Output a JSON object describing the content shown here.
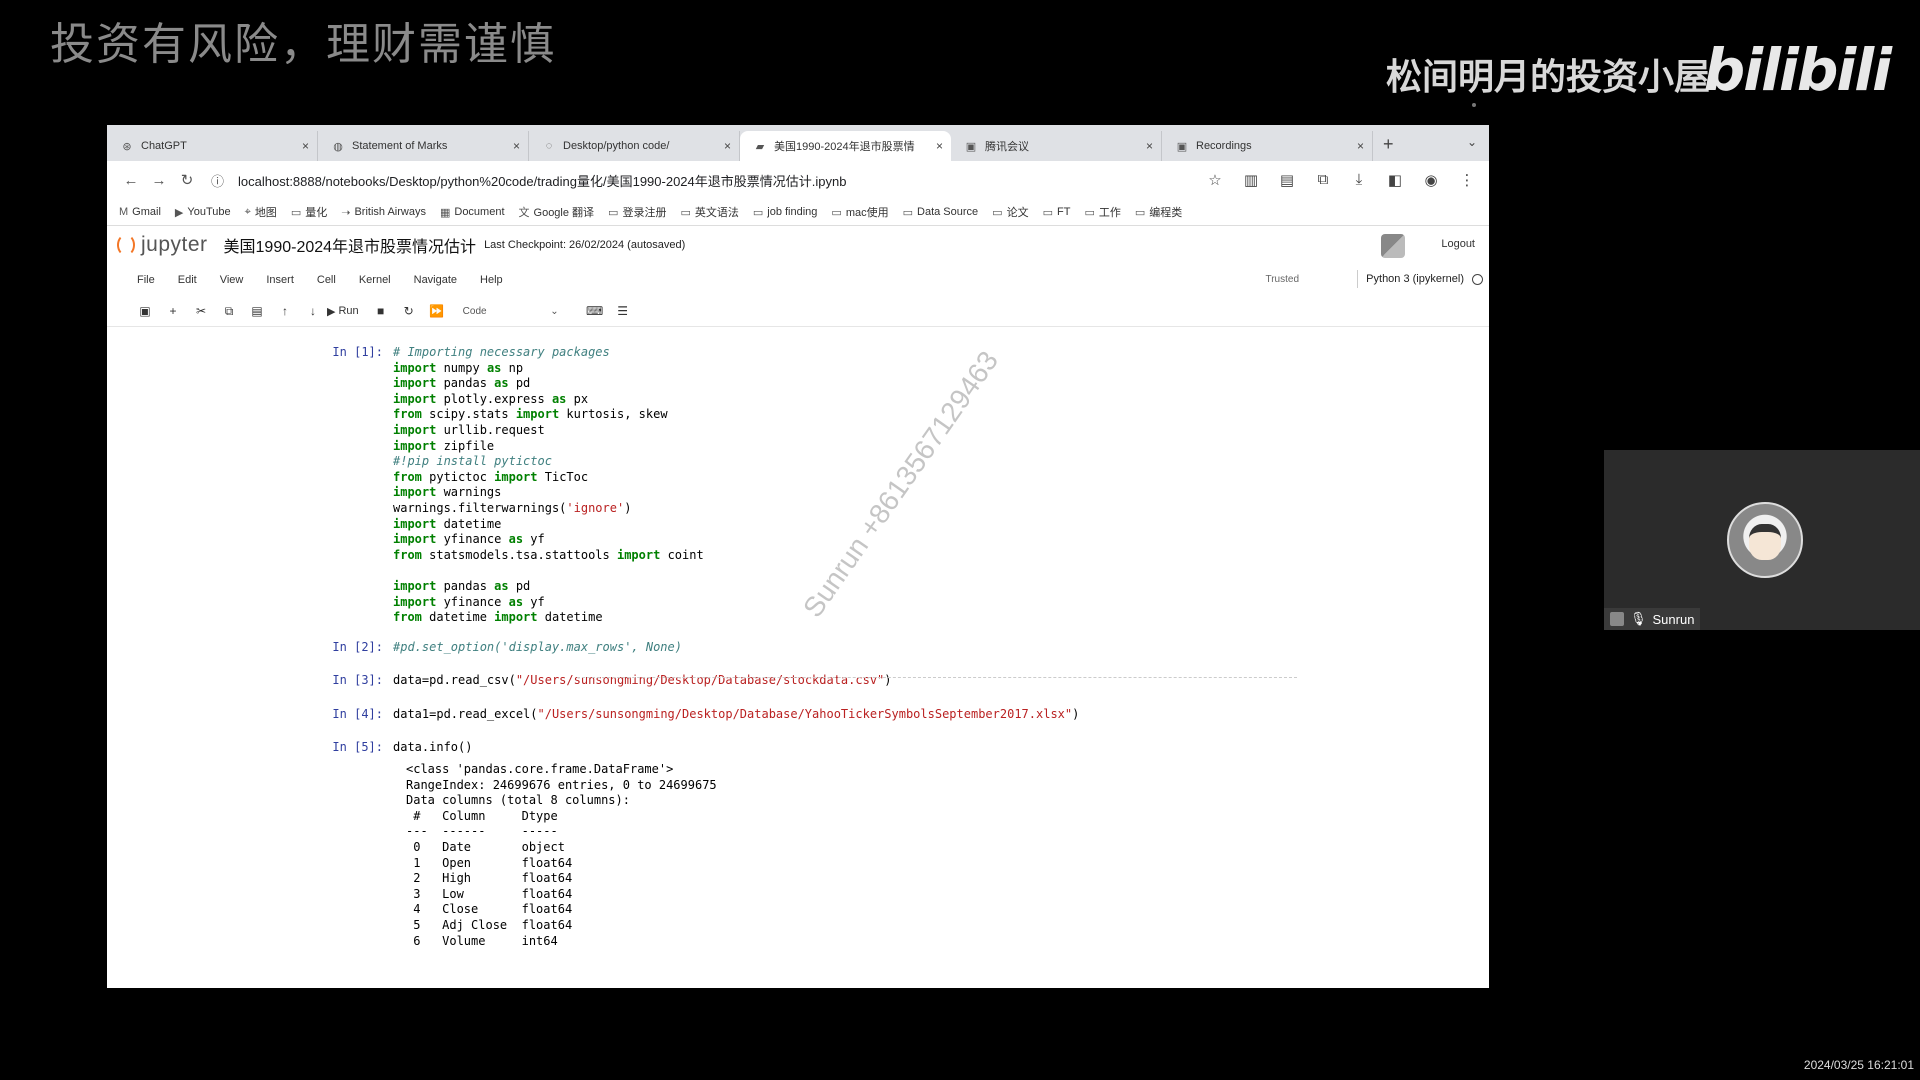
{
  "overlay": {
    "warning": "投资有风险，理财需谨慎",
    "brand": "松间明月的投资小屋",
    "logo": "bilibili",
    "timestamp": "2024/03/25 16:21:01"
  },
  "browser": {
    "tabs": [
      {
        "label": "ChatGPT",
        "icon": "chatgpt-icon"
      },
      {
        "label": "Statement of Marks",
        "icon": "globe-icon"
      },
      {
        "label": "Desktop/python code/",
        "icon": "loading-icon"
      },
      {
        "label": "美国1990-2024年退市股票情",
        "icon": "jupyter-icon",
        "active": true
      },
      {
        "label": "腾讯会议",
        "icon": "meeting-icon"
      },
      {
        "label": "Recordings",
        "icon": "recordings-icon"
      }
    ],
    "new_tab": "+",
    "url": "localhost:8888/notebooks/Desktop/python%20code/trading量化/美国1990-2024年退市股票情况估计.ipynb",
    "bookmarks": [
      {
        "label": "Gmail",
        "icon": "gmail-icon"
      },
      {
        "label": "YouTube",
        "icon": "youtube-icon"
      },
      {
        "label": "地图",
        "icon": "map-pin-icon"
      },
      {
        "label": "量化",
        "icon": "folder-icon"
      },
      {
        "label": "British Airways",
        "icon": "airline-icon"
      },
      {
        "label": "Document",
        "icon": "document-icon"
      },
      {
        "label": "Google 翻译",
        "icon": "translate-icon"
      },
      {
        "label": "登录注册",
        "icon": "folder-icon"
      },
      {
        "label": "英文语法",
        "icon": "folder-icon"
      },
      {
        "label": "job finding",
        "icon": "folder-icon"
      },
      {
        "label": "mac使用",
        "icon": "folder-icon"
      },
      {
        "label": "Data Source",
        "icon": "folder-icon"
      },
      {
        "label": "论文",
        "icon": "folder-icon"
      },
      {
        "label": "FT",
        "icon": "folder-icon"
      },
      {
        "label": "工作",
        "icon": "folder-icon"
      },
      {
        "label": "编程类",
        "icon": "folder-icon"
      }
    ]
  },
  "jupyter": {
    "logo_text": "jupyter",
    "title": "美国1990-2024年退市股票情况估计",
    "checkpoint": "Last Checkpoint: 26/02/2024   (autosaved)",
    "logout": "Logout",
    "menu": [
      "File",
      "Edit",
      "View",
      "Insert",
      "Cell",
      "Kernel",
      "Navigate",
      "Help"
    ],
    "trusted": "Trusted",
    "kernel": "Python 3 (ipykernel)",
    "toolbar": {
      "run": "Run",
      "cell_type": "Code"
    }
  },
  "cells": [
    {
      "prompt": "In [1]:",
      "lines": [
        "# Importing necessary packages",
        "import numpy as np",
        "import pandas as pd",
        "import plotly.express as px",
        "from scipy.stats import kurtosis, skew",
        "import urllib.request",
        "import zipfile",
        "#!pip install pytictoc",
        "from pytictoc import TicToc",
        "import warnings",
        "warnings.filterwarnings('ignore')",
        "import datetime",
        "import yfinance as yf",
        "from statsmodels.tsa.stattools import coint",
        "",
        "import pandas as pd",
        "import yfinance as yf",
        "from datetime import datetime"
      ]
    },
    {
      "prompt": "In [2]:",
      "lines": [
        "#pd.set_option('display.max_rows', None)"
      ]
    },
    {
      "prompt": "In [3]:",
      "lines": [
        "data=pd.read_csv(\"/Users/sunsongming/Desktop/Database/stockdata.csv\")"
      ]
    },
    {
      "prompt": "In [4]:",
      "lines": [
        "data1=pd.read_excel(\"/Users/sunsongming/Desktop/Database/YahooTickerSymbolsSeptember2017.xlsx\")"
      ]
    },
    {
      "prompt": "In [5]:",
      "lines": [
        "data.info()"
      ]
    }
  ],
  "output5": [
    "<class 'pandas.core.frame.DataFrame'>",
    "RangeIndex: 24699676 entries, 0 to 24699675",
    "Data columns (total 8 columns):",
    " #   Column     Dtype  ",
    "---  ------     -----  ",
    " 0   Date       object ",
    " 1   Open       float64",
    " 2   High       float64",
    " 3   Low        float64",
    " 4   Close      float64",
    " 5   Adj Close  float64",
    " 6   Volume     int64  "
  ],
  "watermark": "Sunrun +8613567129463",
  "video": {
    "name": "Sunrun"
  }
}
